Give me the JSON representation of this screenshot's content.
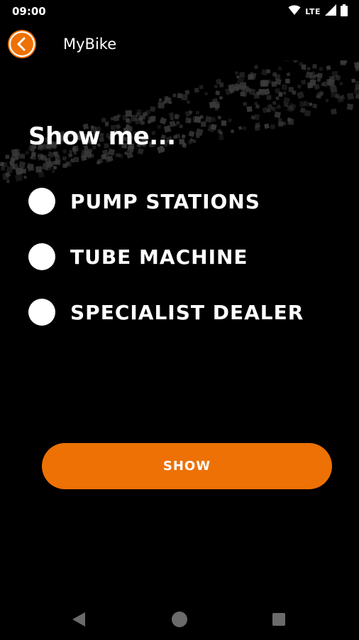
{
  "status_bar": {
    "time": "09:00",
    "network_label": "LTE",
    "icons": [
      "wifi-icon",
      "signal-icon",
      "battery-icon"
    ]
  },
  "app_bar": {
    "title": "MyBike",
    "back_icon": "chevron-left-icon"
  },
  "heading": "Show me...",
  "options": [
    {
      "label": "PUMP STATIONS",
      "selected": false
    },
    {
      "label": "TUBE MACHINE",
      "selected": false
    },
    {
      "label": "SPECIALIST DEALER",
      "selected": false
    }
  ],
  "show_button": {
    "label": "SHOW"
  },
  "colors": {
    "accent": "#ed7104",
    "background": "#000000",
    "text": "#ffffff"
  }
}
